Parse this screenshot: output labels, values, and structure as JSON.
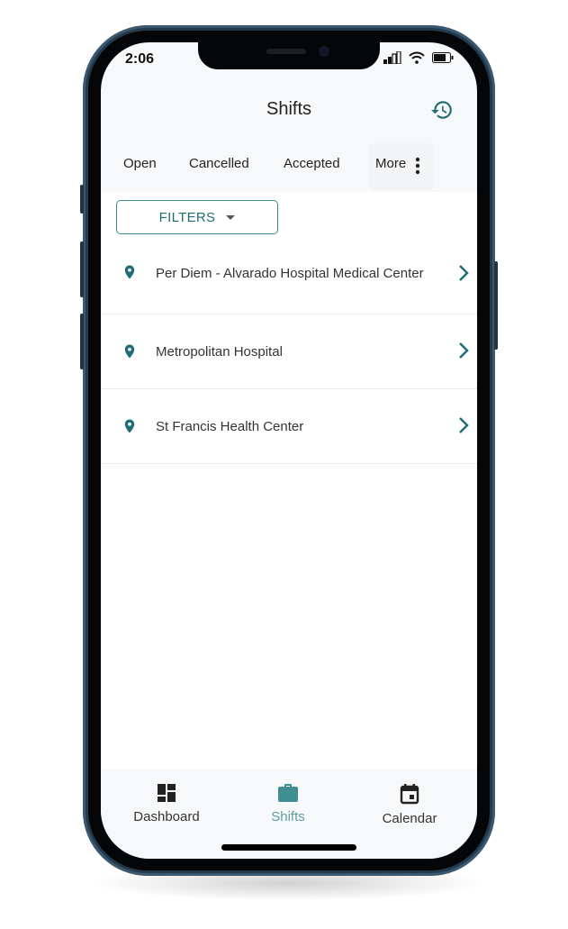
{
  "status_bar": {
    "time": "2:06"
  },
  "header": {
    "title": "Shifts",
    "history_icon": "history-icon"
  },
  "tabs": [
    {
      "label": "Open"
    },
    {
      "label": "Cancelled"
    },
    {
      "label": "Accepted"
    },
    {
      "label": "More",
      "icon": "more-vertical-icon"
    }
  ],
  "filters": {
    "label": "FILTERS"
  },
  "locations": [
    {
      "name": "Per Diem - Alvarado Hospital Medical Center"
    },
    {
      "name": "Metropolitan Hospital"
    },
    {
      "name": "St Francis Health Center"
    }
  ],
  "bottom_nav": [
    {
      "label": "Dashboard",
      "icon": "dashboard-icon",
      "active": false
    },
    {
      "label": "Shifts",
      "icon": "briefcase-icon",
      "active": true
    },
    {
      "label": "Calendar",
      "icon": "calendar-icon",
      "active": false
    }
  ],
  "colors": {
    "accent": "#1f6e74",
    "active_nav": "#4a9aa0",
    "text": "#222222"
  }
}
